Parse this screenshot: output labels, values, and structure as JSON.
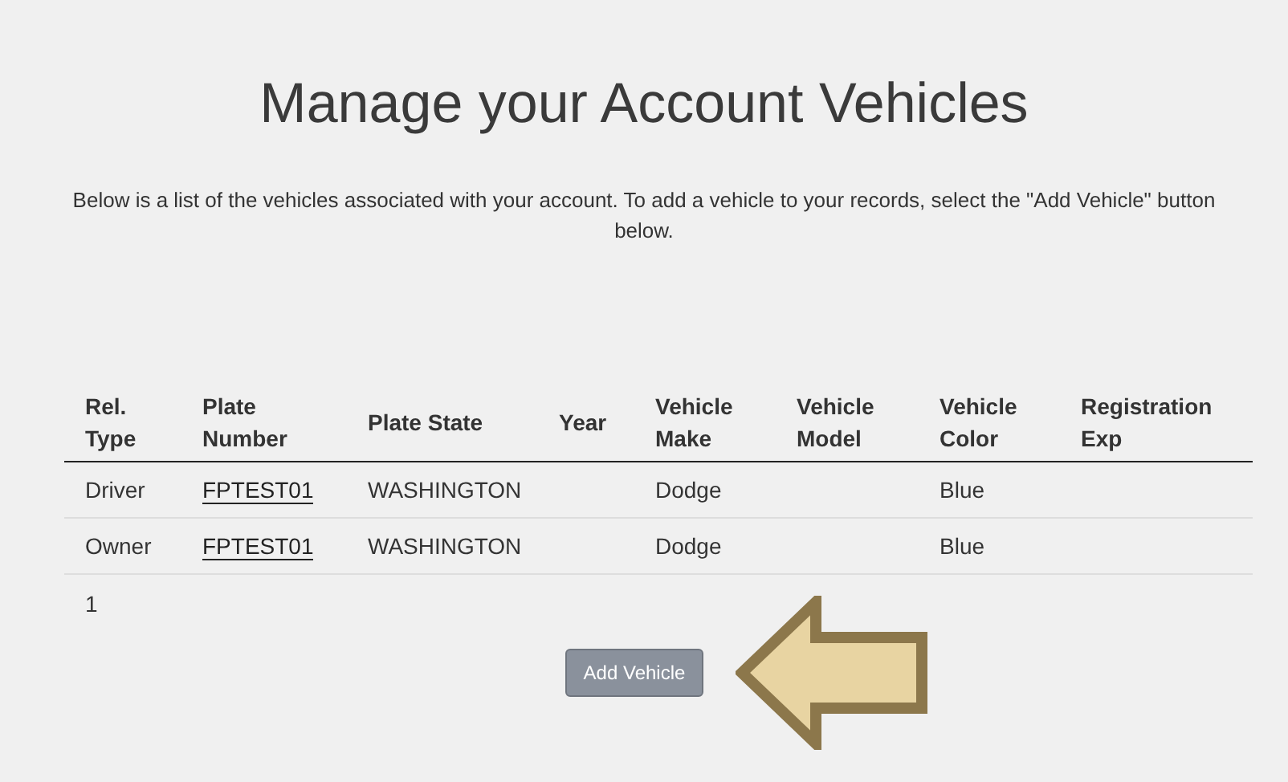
{
  "title": "Manage your Account Vehicles",
  "description": "Below is a list of the vehicles associated with your account. To add a vehicle to your records, select the \"Add Vehicle\" button below.",
  "table": {
    "columns": [
      "Rel. Type",
      "Plate Number",
      "Plate State",
      "Year",
      "Vehicle Make",
      "Vehicle Model",
      "Vehicle Color",
      "Registration Exp"
    ],
    "rows": [
      {
        "rel_type": "Driver",
        "plate_number": "FPTEST01",
        "plate_state": "WASHINGTON",
        "make": "Dodge",
        "vehicle_color": "Blue"
      },
      {
        "rel_type": "Owner",
        "plate_number": "FPTEST01",
        "plate_state": "WASHINGTON",
        "make": "Dodge",
        "vehicle_color": "Blue"
      }
    ]
  },
  "pager": "1",
  "button": "Add Vehicle"
}
